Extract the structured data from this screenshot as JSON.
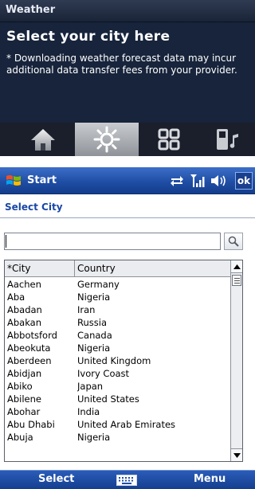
{
  "weather": {
    "header": "Weather",
    "title": "Select your city here",
    "notice": "* Downloading weather forecast data may incur additional data transfer fees from your provider.",
    "tabs": [
      {
        "icon": "home-icon",
        "active": false
      },
      {
        "icon": "sun-icon",
        "active": true
      },
      {
        "icon": "grid-icon",
        "active": false
      },
      {
        "icon": "phone-music-icon",
        "active": false
      }
    ]
  },
  "device": {
    "title_bar": {
      "start_label": "Start",
      "ok_label": "ok",
      "icons": [
        "windows-flag-icon",
        "connectivity-icon",
        "signal-icon",
        "volume-icon"
      ]
    },
    "page_title": "Select City",
    "search": {
      "value": "",
      "placeholder": "",
      "button_icon": "search-icon"
    },
    "list": {
      "columns": [
        "*City",
        "Country"
      ],
      "rows": [
        [
          "Aachen",
          "Germany"
        ],
        [
          "Aba",
          "Nigeria"
        ],
        [
          "Abadan",
          "Iran"
        ],
        [
          "Abakan",
          "Russia"
        ],
        [
          "Abbotsford",
          "Canada"
        ],
        [
          "Abeokuta",
          "Nigeria"
        ],
        [
          "Aberdeen",
          "United Kingdom"
        ],
        [
          "Abidjan",
          "Ivory Coast"
        ],
        [
          "Abiko",
          "Japan"
        ],
        [
          "Abilene",
          "United States"
        ],
        [
          "Abohar",
          "India"
        ],
        [
          "Abu Dhabi",
          "United Arab Emirates"
        ],
        [
          "Abuja",
          "Nigeria"
        ]
      ]
    },
    "soft_keys": {
      "left": "Select",
      "right": "Menu",
      "center_icon": "keyboard-icon"
    }
  },
  "colors": {
    "weather_bg": "#17243b",
    "title_bar_blue": "#1f4ea5",
    "page_title_blue": "#1a47a6"
  }
}
